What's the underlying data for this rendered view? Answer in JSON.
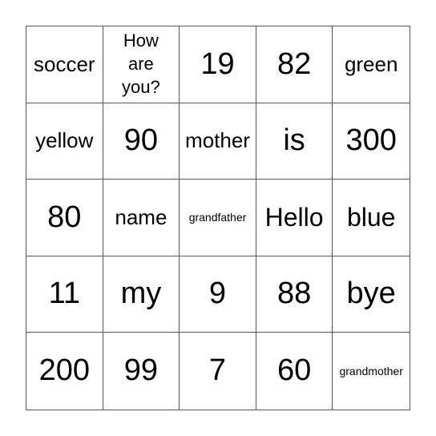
{
  "board": {
    "cells": [
      {
        "text": "soccer",
        "size": "s-md"
      },
      {
        "text": "How are you?",
        "size": "s-sm"
      },
      {
        "text": "19",
        "size": "s-xl"
      },
      {
        "text": "82",
        "size": "s-xl"
      },
      {
        "text": "green",
        "size": "s-md"
      },
      {
        "text": "yellow",
        "size": "s-md"
      },
      {
        "text": "90",
        "size": "s-xl"
      },
      {
        "text": "mother",
        "size": "s-md"
      },
      {
        "text": "is",
        "size": "s-xl"
      },
      {
        "text": "300",
        "size": "s-xl"
      },
      {
        "text": "80",
        "size": "s-xl"
      },
      {
        "text": "name",
        "size": "s-md"
      },
      {
        "text": "grandfather",
        "size": "s-xs"
      },
      {
        "text": "Hello",
        "size": "s-lg"
      },
      {
        "text": "blue",
        "size": "s-lg"
      },
      {
        "text": "11",
        "size": "s-xl"
      },
      {
        "text": "my",
        "size": "s-xl"
      },
      {
        "text": "9",
        "size": "s-xl"
      },
      {
        "text": "88",
        "size": "s-xl"
      },
      {
        "text": "bye",
        "size": "s-xl"
      },
      {
        "text": "200",
        "size": "s-xl"
      },
      {
        "text": "99",
        "size": "s-xl"
      },
      {
        "text": "7",
        "size": "s-xl"
      },
      {
        "text": "60",
        "size": "s-xl"
      },
      {
        "text": "grandmother",
        "size": "s-xs"
      }
    ]
  }
}
